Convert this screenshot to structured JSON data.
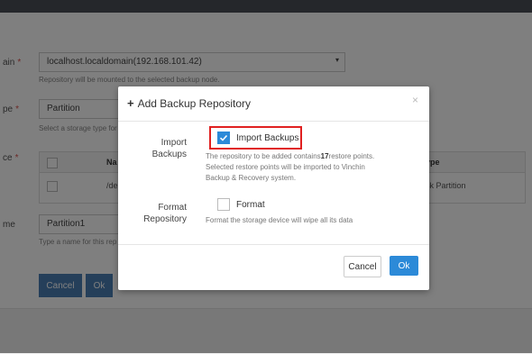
{
  "background": {
    "node_label": "ain",
    "node_value": "localhost.localdomain(192.168.101.42)",
    "node_hint": "Repository will be mounted to the selected backup node.",
    "type_label": "pe",
    "type_value": "Partition",
    "type_hint": "Select a storage type for",
    "source_label": "ce",
    "table_col_name": "Na",
    "table_col_type": "ype",
    "table_row_path": "/de",
    "table_row_type": "sk Partition",
    "name_label": "me",
    "name_value": "Partition1",
    "name_hint": "Type a name for this rep",
    "cancel_label": "Cancel",
    "ok_label": "Ok"
  },
  "modal": {
    "title": "Add Backup Repository",
    "close": "×",
    "import_label": "Import Backups",
    "import_checkbox_label": "Import Backups",
    "import_checked": true,
    "import_desc_pre": "The repository to be added contains",
    "import_desc_count": "17",
    "import_desc_post": "restore points.",
    "import_desc_line2": "Selected restore points will be imported to Vinchin",
    "import_desc_line3": "Backup & Recovery system.",
    "format_label": "Format Repository",
    "format_checkbox_label": "Format",
    "format_checked": false,
    "format_desc": "Format the storage device will wipe all its data",
    "cancel_label": "Cancel",
    "ok_label": "Ok"
  },
  "colors": {
    "accent": "#2c8ad8",
    "highlight": "#e02020",
    "required": "#d9534f"
  }
}
